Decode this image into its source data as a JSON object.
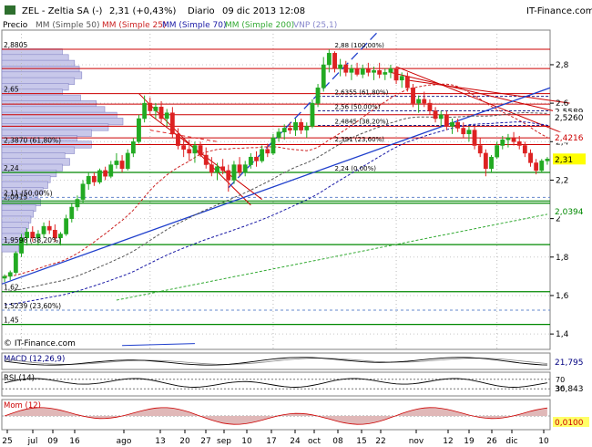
{
  "header": {
    "ticker": "ZEL - Zeltia SA (-)",
    "price_change": "2,31 (+0,43%)",
    "period": "Diario",
    "datetime": "09 dic 2013 12:08",
    "brand": "IT-Finance.com",
    "watermark": "© IT-Finance.com"
  },
  "legend": {
    "price": "Precio",
    "ma50": "MM (Simple 50)",
    "ma25": "MM (Simple 25)",
    "ma70": "MM (Simple 70)",
    "ma200": "MM (Simple 200)",
    "vnp": "VNP (25,1)"
  },
  "colors": {
    "up": "#22aa22",
    "down": "#dd2222",
    "ma25": "#cc2222",
    "ma50": "#555555",
    "ma70": "#1a1aa6",
    "ma200": "#33aa33",
    "resistance": "#cc0000",
    "support": "#008800",
    "trend": "#1f3fcc",
    "vnp": "#9999dd",
    "macd": "#000080",
    "rsi_line": "#000000",
    "mom_line": "#cc0000",
    "mom_fill": "#e0b8b8"
  },
  "chart_data": {
    "type": "candlestick",
    "ylim": [
      1.32,
      2.98
    ],
    "y_ticks": [
      "2,8",
      "2,6",
      "2,4",
      "2,2",
      "2",
      "1,8",
      "1,6",
      "1,4"
    ],
    "x_labels": [
      "25",
      "jul",
      "09",
      "16",
      "ago",
      "13",
      "20",
      "27",
      "sep",
      "10",
      "17",
      "24",
      "oct",
      "08",
      "15",
      "22",
      "nov",
      "12",
      "19",
      "26",
      "dic",
      "10"
    ],
    "right_labels": [
      {
        "value": 2.5589,
        "text": "2,5589"
      },
      {
        "value": 2.526,
        "text": "2,5260"
      },
      {
        "value": 2.4216,
        "text": "2,4216"
      },
      {
        "value": 2.31,
        "text": "2,31"
      },
      {
        "value": 2.0394,
        "text": "2,0394"
      }
    ],
    "level_labels": [
      {
        "value": 2.8805,
        "text": "2,8805"
      },
      {
        "value": 2.65,
        "text": "2,65"
      },
      {
        "value": 2.385,
        "text": "2,3870 (61,80%)"
      },
      {
        "value": 2.24,
        "text": "2,24"
      },
      {
        "value": 2.11,
        "text": "2,11 (50,00%)"
      },
      {
        "value": 2.0915,
        "text": "2,0915"
      },
      {
        "value": 1.865,
        "text": "1,9598 (38,20%)"
      },
      {
        "value": 1.62,
        "text": "1,62"
      },
      {
        "value": 1.5239,
        "text": "1,5239 (23,60%)"
      },
      {
        "value": 1.45,
        "text": "1,45"
      }
    ],
    "fib_labels": [
      {
        "value": 2.88,
        "text": "2,88 (100,00%)"
      },
      {
        "value": 2.6355,
        "text": "2,6355 (61,80%)"
      },
      {
        "value": 2.56,
        "text": "2,56 (50,00%)"
      },
      {
        "value": 2.4845,
        "text": "2,4845 (38,20%)"
      },
      {
        "value": 2.391,
        "text": "2,391 (23,60%)"
      },
      {
        "value": 2.24,
        "text": "2,24 (0,00%)"
      }
    ],
    "candles": [
      [
        1.69,
        1.71,
        1.67,
        1.7
      ],
      [
        1.7,
        1.73,
        1.68,
        1.72
      ],
      [
        1.72,
        1.83,
        1.71,
        1.82
      ],
      [
        1.82,
        1.92,
        1.8,
        1.9
      ],
      [
        1.9,
        1.95,
        1.86,
        1.93
      ],
      [
        1.93,
        1.96,
        1.88,
        1.9
      ],
      [
        1.9,
        1.94,
        1.86,
        1.92
      ],
      [
        1.92,
        1.98,
        1.9,
        1.96
      ],
      [
        1.96,
        1.99,
        1.92,
        1.94
      ],
      [
        1.94,
        1.97,
        1.88,
        1.9
      ],
      [
        1.9,
        1.93,
        1.86,
        1.92
      ],
      [
        1.92,
        2.02,
        1.91,
        2.0
      ],
      [
        2.0,
        2.08,
        1.98,
        2.06
      ],
      [
        2.06,
        2.12,
        2.04,
        2.1
      ],
      [
        2.1,
        2.2,
        2.08,
        2.18
      ],
      [
        2.18,
        2.24,
        2.15,
        2.22
      ],
      [
        2.22,
        2.24,
        2.17,
        2.19
      ],
      [
        2.19,
        2.26,
        2.18,
        2.25
      ],
      [
        2.25,
        2.27,
        2.2,
        2.22
      ],
      [
        2.22,
        2.3,
        2.21,
        2.28
      ],
      [
        2.28,
        2.34,
        2.26,
        2.3
      ],
      [
        2.3,
        2.33,
        2.24,
        2.26
      ],
      [
        2.26,
        2.36,
        2.25,
        2.34
      ],
      [
        2.34,
        2.42,
        2.32,
        2.4
      ],
      [
        2.4,
        2.54,
        2.39,
        2.52
      ],
      [
        2.52,
        2.64,
        2.5,
        2.6
      ],
      [
        2.6,
        2.63,
        2.54,
        2.56
      ],
      [
        2.56,
        2.6,
        2.52,
        2.58
      ],
      [
        2.58,
        2.61,
        2.5,
        2.52
      ],
      [
        2.52,
        2.57,
        2.48,
        2.55
      ],
      [
        2.55,
        2.58,
        2.42,
        2.44
      ],
      [
        2.44,
        2.47,
        2.36,
        2.38
      ],
      [
        2.38,
        2.42,
        2.32,
        2.36
      ],
      [
        2.36,
        2.41,
        2.3,
        2.34
      ],
      [
        2.34,
        2.4,
        2.29,
        2.38
      ],
      [
        2.38,
        2.4,
        2.32,
        2.33
      ],
      [
        2.33,
        2.37,
        2.26,
        2.28
      ],
      [
        2.28,
        2.32,
        2.22,
        2.24
      ],
      [
        2.24,
        2.29,
        2.2,
        2.27
      ],
      [
        2.27,
        2.31,
        2.23,
        2.25
      ],
      [
        2.25,
        2.28,
        2.14,
        2.2
      ],
      [
        2.2,
        2.3,
        2.18,
        2.28
      ],
      [
        2.28,
        2.32,
        2.22,
        2.24
      ],
      [
        2.24,
        2.3,
        2.22,
        2.28
      ],
      [
        2.28,
        2.34,
        2.26,
        2.32
      ],
      [
        2.32,
        2.35,
        2.27,
        2.3
      ],
      [
        2.3,
        2.38,
        2.29,
        2.36
      ],
      [
        2.36,
        2.39,
        2.32,
        2.34
      ],
      [
        2.34,
        2.44,
        2.33,
        2.42
      ],
      [
        2.42,
        2.47,
        2.4,
        2.45
      ],
      [
        2.45,
        2.49,
        2.41,
        2.47
      ],
      [
        2.47,
        2.5,
        2.44,
        2.46
      ],
      [
        2.46,
        2.52,
        2.43,
        2.5
      ],
      [
        2.5,
        2.52,
        2.44,
        2.46
      ],
      [
        2.46,
        2.5,
        2.42,
        2.48
      ],
      [
        2.48,
        2.62,
        2.47,
        2.6
      ],
      [
        2.6,
        2.7,
        2.58,
        2.68
      ],
      [
        2.68,
        2.84,
        2.66,
        2.8
      ],
      [
        2.8,
        2.88,
        2.76,
        2.86
      ],
      [
        2.86,
        2.87,
        2.76,
        2.78
      ],
      [
        2.78,
        2.83,
        2.74,
        2.8
      ],
      [
        2.8,
        2.82,
        2.74,
        2.76
      ],
      [
        2.76,
        2.8,
        2.72,
        2.78
      ],
      [
        2.78,
        2.81,
        2.74,
        2.75
      ],
      [
        2.75,
        2.8,
        2.73,
        2.78
      ],
      [
        2.78,
        2.81,
        2.74,
        2.76
      ],
      [
        2.76,
        2.79,
        2.72,
        2.77
      ],
      [
        2.77,
        2.81,
        2.73,
        2.75
      ],
      [
        2.75,
        2.78,
        2.72,
        2.76
      ],
      [
        2.76,
        2.8,
        2.73,
        2.78
      ],
      [
        2.78,
        2.79,
        2.7,
        2.72
      ],
      [
        2.72,
        2.76,
        2.68,
        2.74
      ],
      [
        2.74,
        2.76,
        2.66,
        2.68
      ],
      [
        2.68,
        2.7,
        2.58,
        2.6
      ],
      [
        2.6,
        2.64,
        2.55,
        2.62
      ],
      [
        2.62,
        2.66,
        2.58,
        2.6
      ],
      [
        2.6,
        2.62,
        2.54,
        2.56
      ],
      [
        2.56,
        2.58,
        2.5,
        2.52
      ],
      [
        2.52,
        2.56,
        2.48,
        2.54
      ],
      [
        2.54,
        2.56,
        2.46,
        2.48
      ],
      [
        2.48,
        2.52,
        2.44,
        2.5
      ],
      [
        2.5,
        2.52,
        2.45,
        2.47
      ],
      [
        2.47,
        2.5,
        2.42,
        2.44
      ],
      [
        2.44,
        2.48,
        2.4,
        2.46
      ],
      [
        2.46,
        2.48,
        2.36,
        2.38
      ],
      [
        2.38,
        2.42,
        2.32,
        2.34
      ],
      [
        2.34,
        2.36,
        2.22,
        2.26
      ],
      [
        2.26,
        2.33,
        2.24,
        2.32
      ],
      [
        2.32,
        2.4,
        2.31,
        2.38
      ],
      [
        2.38,
        2.43,
        2.36,
        2.41
      ],
      [
        2.41,
        2.44,
        2.37,
        2.42
      ],
      [
        2.42,
        2.45,
        2.38,
        2.4
      ],
      [
        2.4,
        2.43,
        2.36,
        2.38
      ],
      [
        2.38,
        2.4,
        2.32,
        2.34
      ],
      [
        2.34,
        2.36,
        2.27,
        2.29
      ],
      [
        2.29,
        2.31,
        2.23,
        2.25
      ],
      [
        2.25,
        2.31,
        2.24,
        2.3
      ],
      [
        2.3,
        2.32,
        2.28,
        2.31
      ]
    ],
    "vnp_bars": [
      [
        2.865,
        0.5
      ],
      [
        2.835,
        0.55
      ],
      [
        2.805,
        0.6
      ],
      [
        2.775,
        0.64
      ],
      [
        2.745,
        0.66
      ],
      [
        2.715,
        0.6
      ],
      [
        2.685,
        0.55
      ],
      [
        2.655,
        0.5
      ],
      [
        2.625,
        0.65
      ],
      [
        2.595,
        0.78
      ],
      [
        2.565,
        0.85
      ],
      [
        2.535,
        0.95
      ],
      [
        2.505,
        1.0
      ],
      [
        2.475,
        0.88
      ],
      [
        2.445,
        0.74
      ],
      [
        2.415,
        0.62
      ],
      [
        2.385,
        0.74
      ],
      [
        2.355,
        0.6
      ],
      [
        2.325,
        0.52
      ],
      [
        2.295,
        0.56
      ],
      [
        2.265,
        0.5
      ],
      [
        2.235,
        0.45
      ],
      [
        2.205,
        0.4
      ],
      [
        2.175,
        0.38
      ],
      [
        2.145,
        0.34
      ],
      [
        2.115,
        0.3
      ],
      [
        2.085,
        0.32
      ],
      [
        2.055,
        0.28
      ],
      [
        2.025,
        0.26
      ],
      [
        1.995,
        0.24
      ],
      [
        1.965,
        0.22
      ],
      [
        1.935,
        0.2
      ],
      [
        1.905,
        0.18
      ],
      [
        1.875,
        0.16
      ],
      [
        1.845,
        0.14
      ]
    ],
    "indicators": {
      "macd": {
        "label": "MACD (12,26,9)",
        "value_text": "21,795"
      },
      "rsi": {
        "label": "RSI (14)",
        "value_text": "36,843",
        "ticks": [
          "70",
          "30"
        ]
      },
      "mom": {
        "label": "Mom (12)",
        "value_text": "0,0100"
      }
    }
  }
}
